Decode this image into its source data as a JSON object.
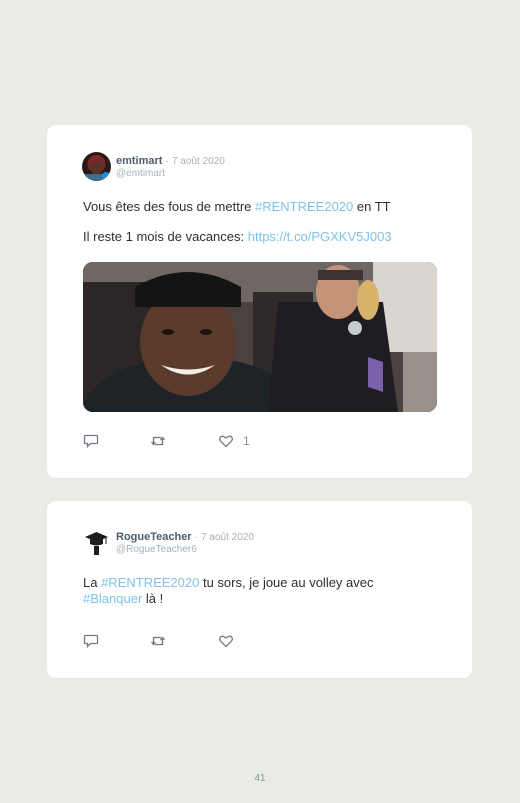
{
  "tweets": [
    {
      "author": "emtimart",
      "separator": "·",
      "date": "7 août 2020",
      "handle": "@emtimart",
      "line1_prefix": "Vous êtes des fous de mettre ",
      "line1_hashtag": "#RENTREE2020",
      "line1_suffix": " en TT",
      "line2_prefix": "Il reste 1 mois de vacances: ",
      "line2_link": "https://t.co/PGXKV5J003",
      "likes": "1",
      "icons": [
        "reply-icon",
        "retweet-icon",
        "heart-icon"
      ]
    },
    {
      "author": "RogueTeacher",
      "separator": "·",
      "date": "7 août 2020",
      "handle": "@RogueTeacher6",
      "line1_prefix": "La ",
      "line1_hashtag": "#RENTREE2020",
      "line1_suffix": " tu sors, je joue au volley avec",
      "line2_hashtag": "#Blanquer",
      "line2_suffix": " là !",
      "icons": [
        "reply-icon",
        "retweet-icon",
        "heart-icon"
      ]
    }
  ],
  "page_number": "41",
  "colors": {
    "background": "#e9ece6",
    "card": "#ffffff",
    "link": "#7ec3e6",
    "author": "#4f5c6a",
    "muted": "#a7b1b9"
  }
}
